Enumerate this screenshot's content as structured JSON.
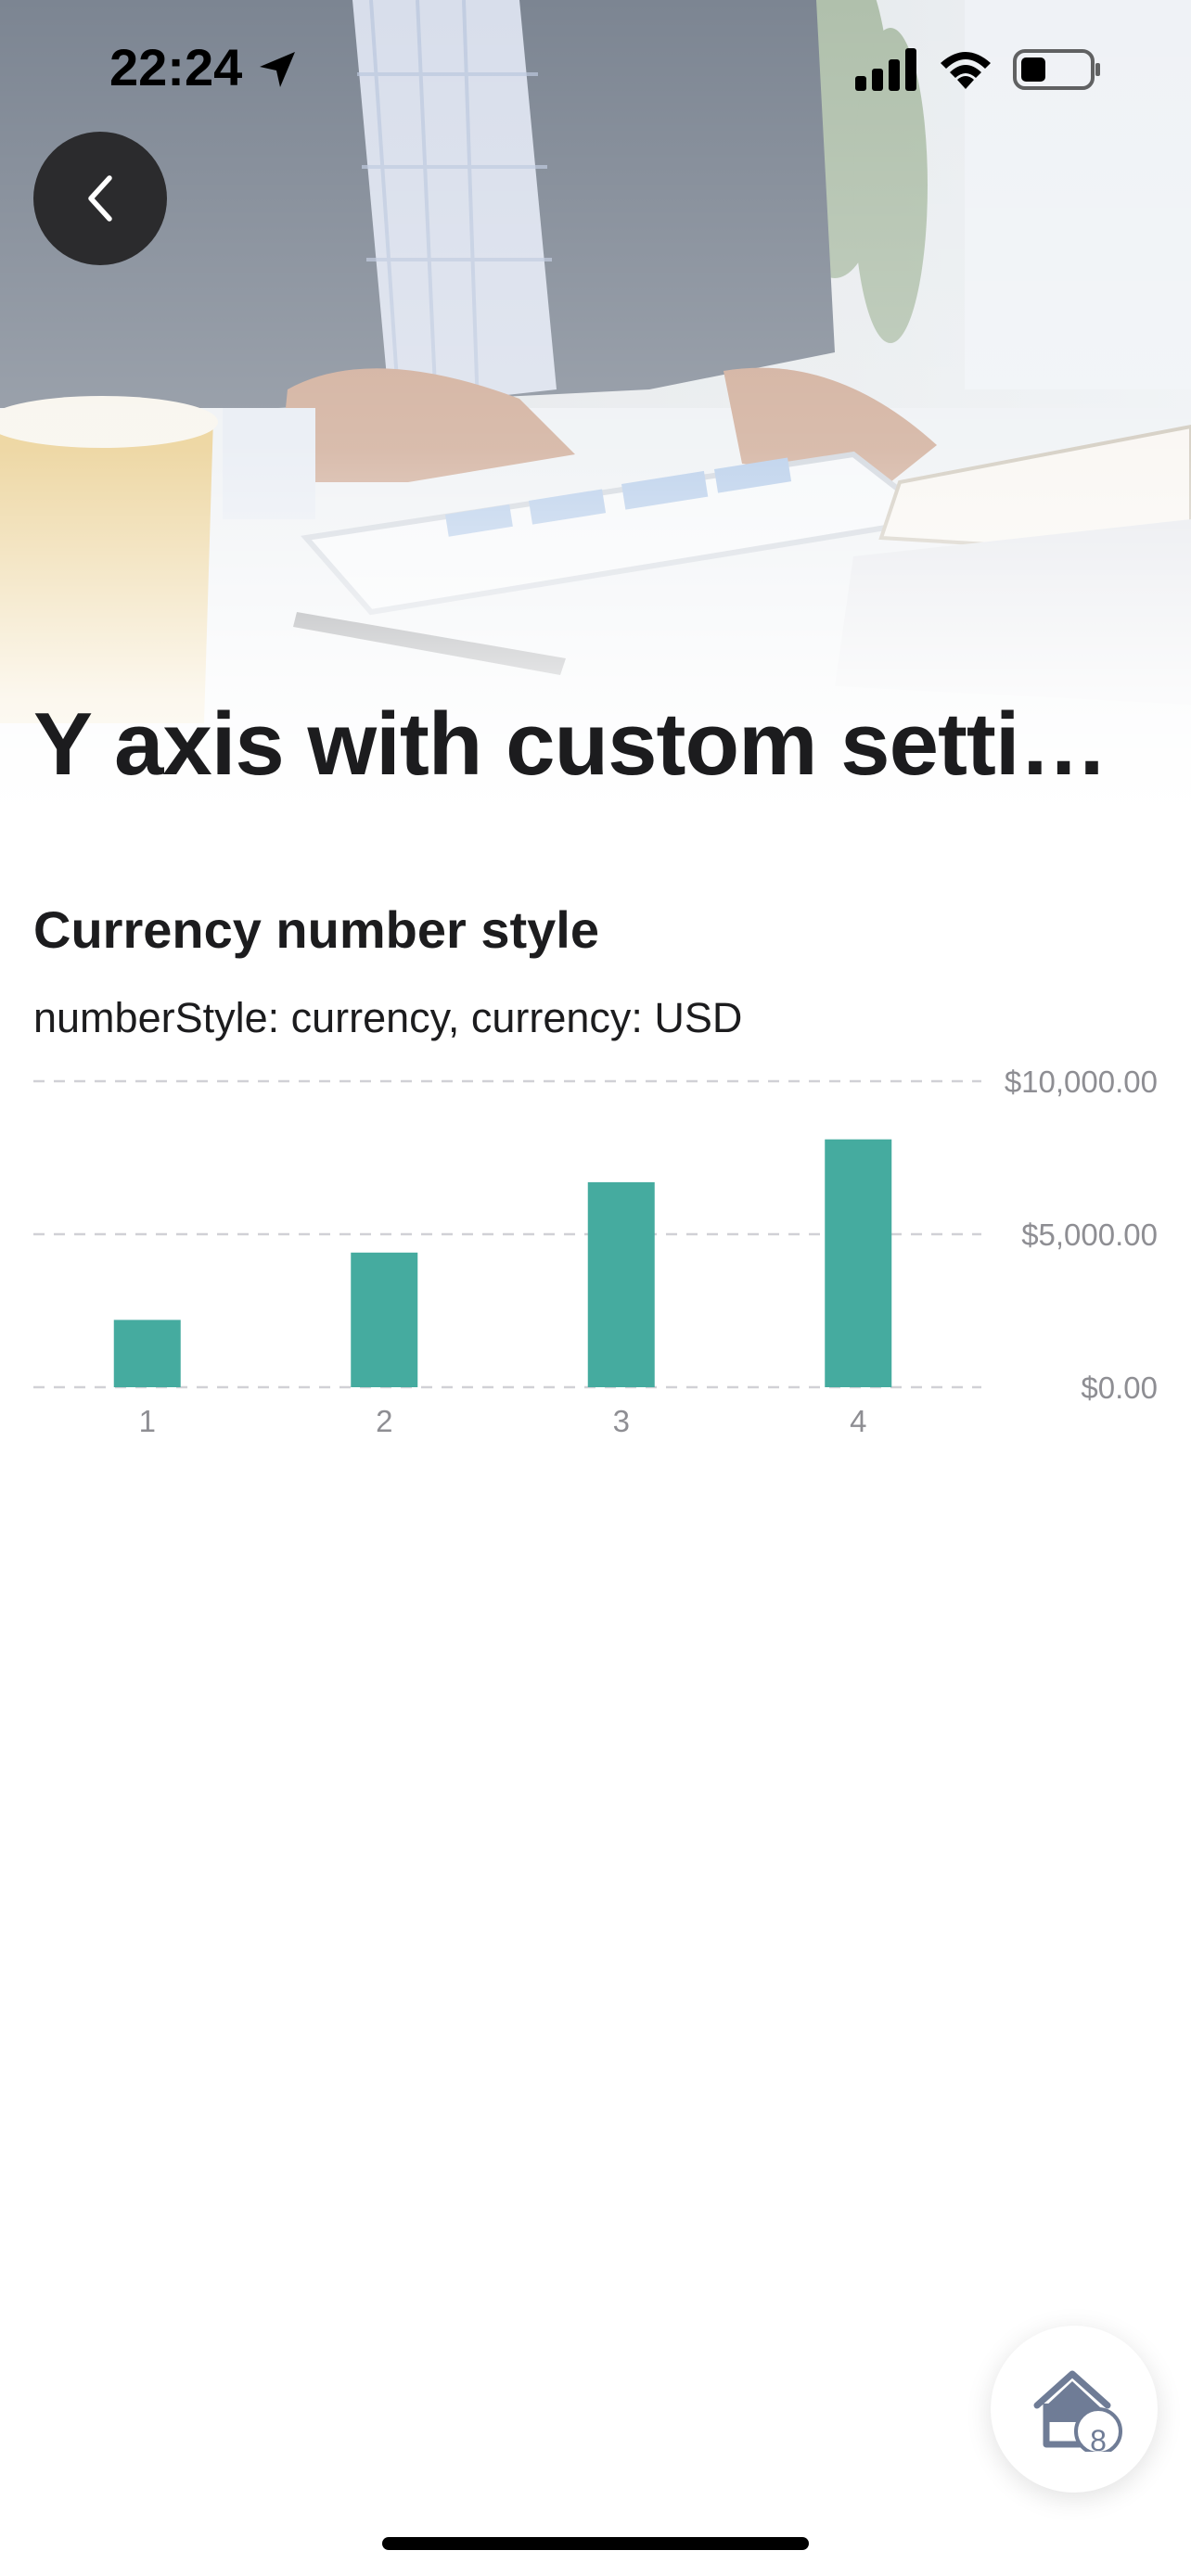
{
  "status_bar": {
    "time": "22:24",
    "icons": [
      "location-arrow-icon",
      "cellular-signal-icon",
      "wifi-icon",
      "battery-icon"
    ]
  },
  "header": {
    "back_icon": "chevron-left-icon",
    "title": "Y axis with custom setti…"
  },
  "section": {
    "title": "Currency number style",
    "subtitle": "numberStyle: currency, currency: USD"
  },
  "chart_data": {
    "type": "bar",
    "categories": [
      "1",
      "2",
      "3",
      "4"
    ],
    "values": [
      2200,
      4400,
      6700,
      8100
    ],
    "y_ticks": [
      {
        "value": 10000,
        "label": "$10,000.00"
      },
      {
        "value": 5000,
        "label": "$5,000.00"
      },
      {
        "value": 0,
        "label": "$0.00"
      }
    ],
    "ylim": [
      0,
      10000
    ],
    "y_axis_position": "right",
    "grid": "dashed horizontal",
    "bar_color": "#45ab9f",
    "grid_color": "#d1d1d6",
    "label_color": "#8e8e93"
  },
  "fab": {
    "icon": "home-icon",
    "badge": "8"
  },
  "colors": {
    "title": "#1c1c1e",
    "back_button": "#2b2b2d",
    "fab_icon": "#6f7c96"
  }
}
